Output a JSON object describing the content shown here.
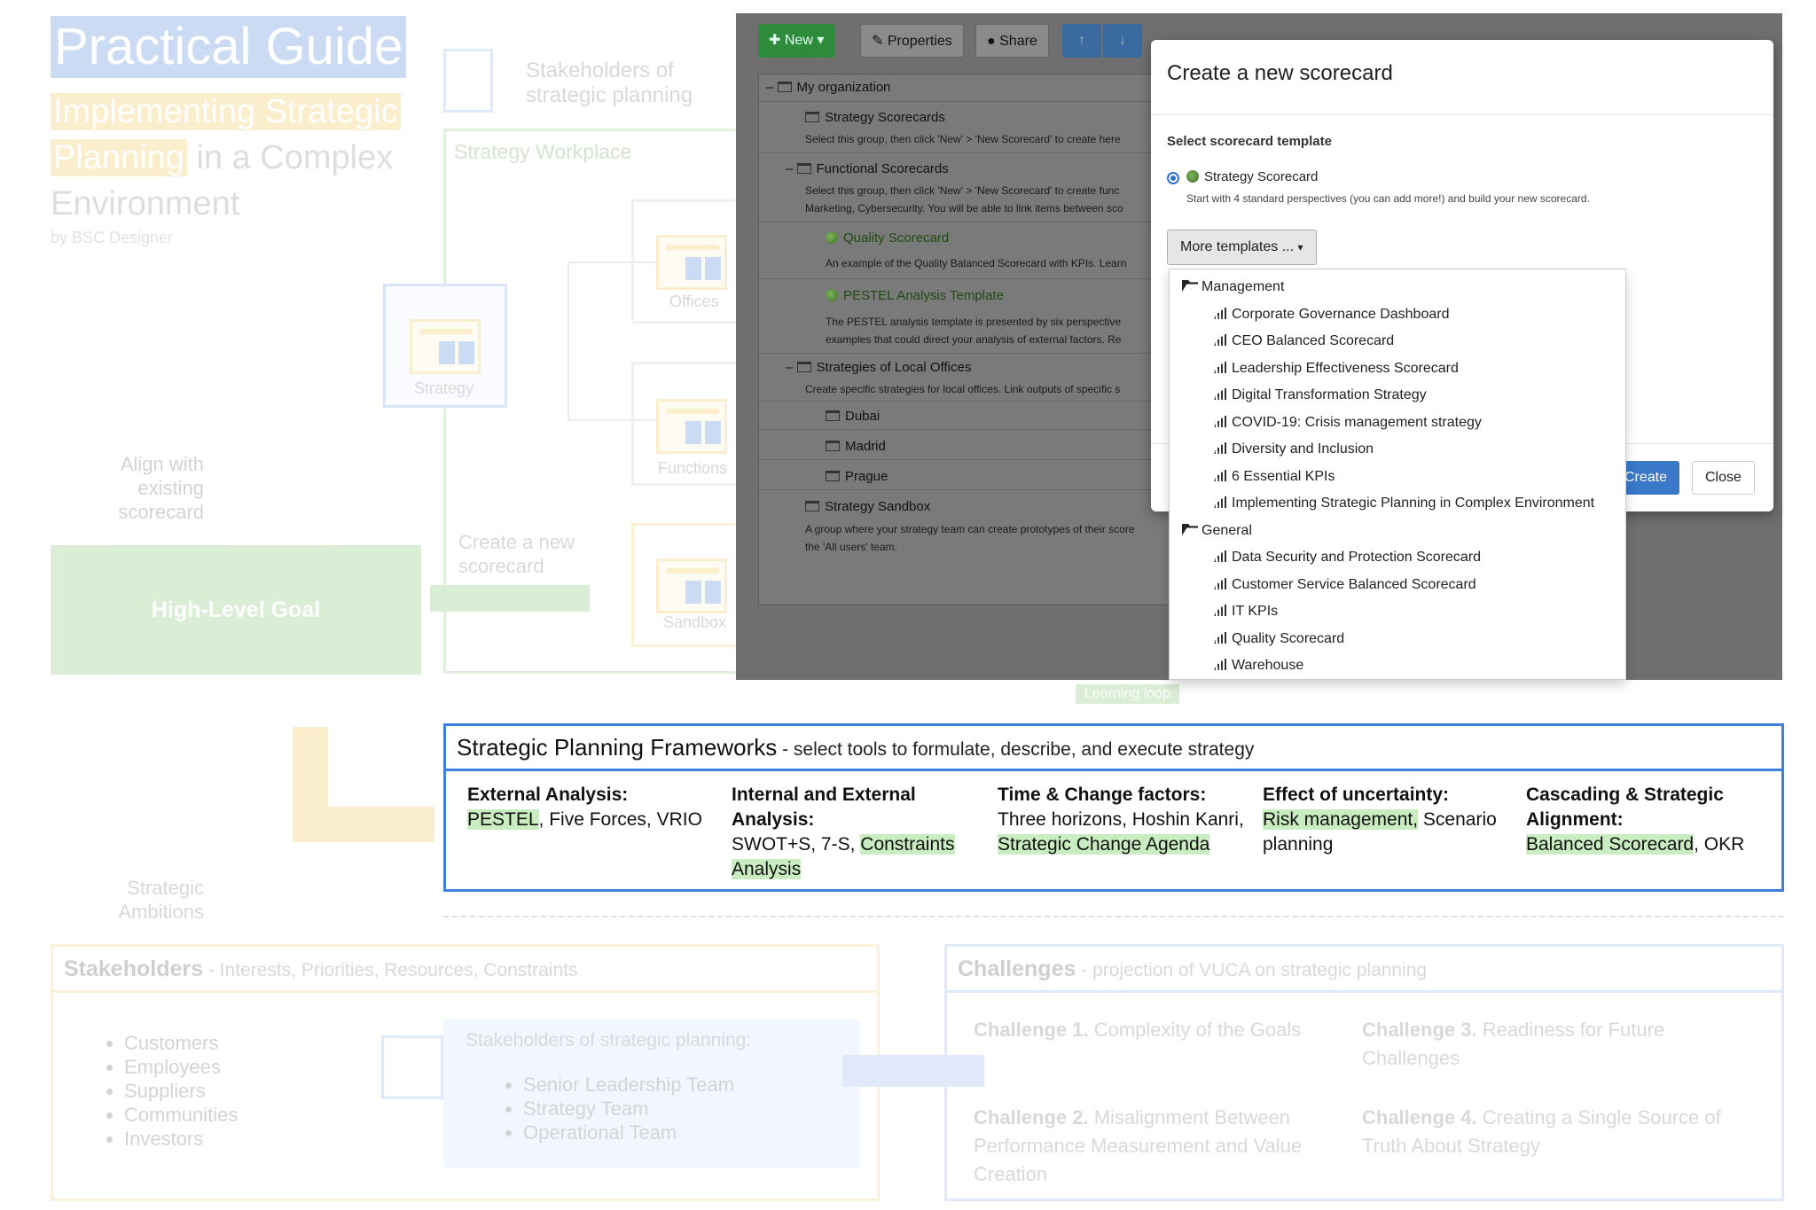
{
  "infographic": {
    "title": "Practical Guide",
    "subtitle_hl1": "Implementing Strategic",
    "subtitle_hl2": "Planning",
    "subtitle_rest1": " in a Complex",
    "subtitle_rest2": "Environment",
    "byline": "by BSC Designer",
    "stakeholders_top": "Stakeholders of strategic planning",
    "strategy_workplace": "Strategy Workplace",
    "strategy": "Strategy",
    "offices": "Offices",
    "functions": "Functions",
    "sandbox": "Sandbox",
    "align": "Align with existing scorecard",
    "create_new": "Create a new scorecard",
    "high_level_goal": "High-Level Goal",
    "learning_loop": "Learning loop",
    "strategic_ambitions": "Strategic Ambitions"
  },
  "toolbar": {
    "new_label": "New",
    "properties_label": "Properties",
    "share_label": "Share"
  },
  "tree": {
    "root": "My organization",
    "items": [
      {
        "label": "Strategy Scorecards",
        "desc": "Select this group, then click 'New' > 'New Scorecard' to create here"
      },
      {
        "label": "Functional Scorecards",
        "desc": "Select this group, then click 'New' > 'New Scorecard' to create func",
        "desc2": "Marketing, Cybersecurity. You will be able to link items between sco"
      },
      {
        "label": "Quality Scorecard",
        "desc": "An example of the Quality Balanced Scorecard with KPIs. Learn"
      },
      {
        "label": "PESTEL Analysis Template",
        "desc": "The PESTEL analysis template is presented by six perspective",
        "desc2": "examples that could direct your analysis of external factors. Re"
      },
      {
        "label": "Strategies of Local Offices",
        "desc": "Create specific strategies for local offices. Link outputs of specific s"
      },
      {
        "label": "Dubai"
      },
      {
        "label": "Madrid"
      },
      {
        "label": "Prague"
      },
      {
        "label": "Strategy Sandbox",
        "desc": "A group where your strategy team can create prototypes of their score",
        "desc2": "the 'All users' team."
      }
    ]
  },
  "dialog": {
    "title": "Create a new scorecard",
    "template_heading": "Select scorecard template",
    "radio_label": "Strategy Scorecard",
    "radio_desc": "Start with 4 standard perspectives (you can add more!) and build your new scorecard.",
    "more_templates": "More templates ...",
    "create_label": "Create",
    "close_label": "Close"
  },
  "menu": {
    "groups": [
      {
        "name": "Management",
        "items": [
          "Corporate Governance Dashboard",
          "CEO Balanced Scorecard",
          "Leadership Effectiveness Scorecard",
          "Digital Transformation Strategy",
          "COVID-19: Crisis management strategy",
          "Diversity and Inclusion",
          "6 Essential KPIs",
          "Implementing Strategic Planning in Complex Environment"
        ]
      },
      {
        "name": "General",
        "items": [
          "Data Security and Protection Scorecard",
          "Customer Service Balanced Scorecard",
          "IT KPIs",
          "Quality Scorecard",
          "Warehouse"
        ]
      }
    ]
  },
  "frameworks": {
    "title": "Strategic Planning Frameworks",
    "subtitle": " - select tools to formulate, describe, and execute strategy",
    "columns": [
      {
        "head": "External Analysis:",
        "g1": "PESTEL",
        "rest": ", Five Forces, VRIO"
      },
      {
        "head": "Internal and External Analysis:",
        "plain": "SWOT+S, 7-S, ",
        "g1": "Constraints Analysis"
      },
      {
        "head": "Time & Change factors:",
        "plain": "Three horizons, Hoshin Kanri, ",
        "g1": "Strategic Change Agenda"
      },
      {
        "head": "Effect of uncertainty:",
        "g1": "Risk management,",
        "rest": " Scenario planning"
      },
      {
        "head": "Cascading & Strategic Alignment:",
        "g1": "Balanced Scorecard",
        "rest": ", OKR"
      }
    ]
  },
  "stakeholders": {
    "title": "Stakeholders",
    "subtitle": " - Interests, Priorities, Resources, Constraints",
    "list": [
      "Customers",
      "Employees",
      "Suppliers",
      "Communities",
      "Investors"
    ],
    "inner_title": "Stakeholders of strategic planning:",
    "inner_list": [
      "Senior Leadership Team",
      "Strategy Team",
      "Operational Team"
    ]
  },
  "challenges": {
    "title": "Challenges",
    "subtitle": " - projection of VUCA on strategic planning",
    "items": [
      {
        "label": "Challenge 1.",
        "text": " Complexity of the Goals"
      },
      {
        "label": "Challenge 2.",
        "text": " Misalignment Between Performance Measurement and Value Creation"
      },
      {
        "label": "Challenge 3.",
        "text": " Readiness for Future Challenges"
      },
      {
        "label": "Challenge 4.",
        "text": " Creating a Single Source of Truth About Strategy"
      }
    ]
  }
}
